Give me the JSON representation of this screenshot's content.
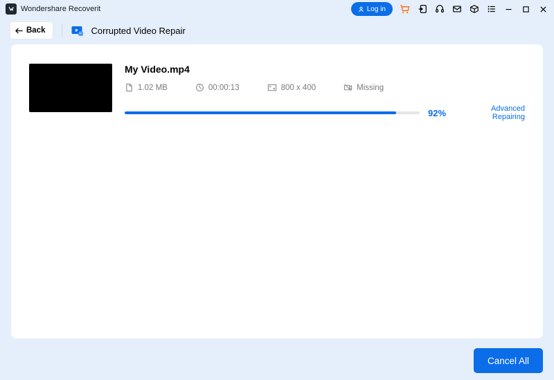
{
  "app": {
    "title": "Wondershare Recoverit"
  },
  "titlebar": {
    "login_label": "Log in"
  },
  "subheader": {
    "back_label": "Back",
    "feature_title": "Corrupted Video Repair"
  },
  "video": {
    "filename": "My Video.mp4",
    "size": "1.02  MB",
    "duration": "00:00:13",
    "dimensions": "800 x 400",
    "missing": "Missing",
    "progress_pct": 92,
    "progress_label": "92%",
    "status": "Advanced Repairing"
  },
  "footer": {
    "cancel_all_label": "Cancel All"
  }
}
